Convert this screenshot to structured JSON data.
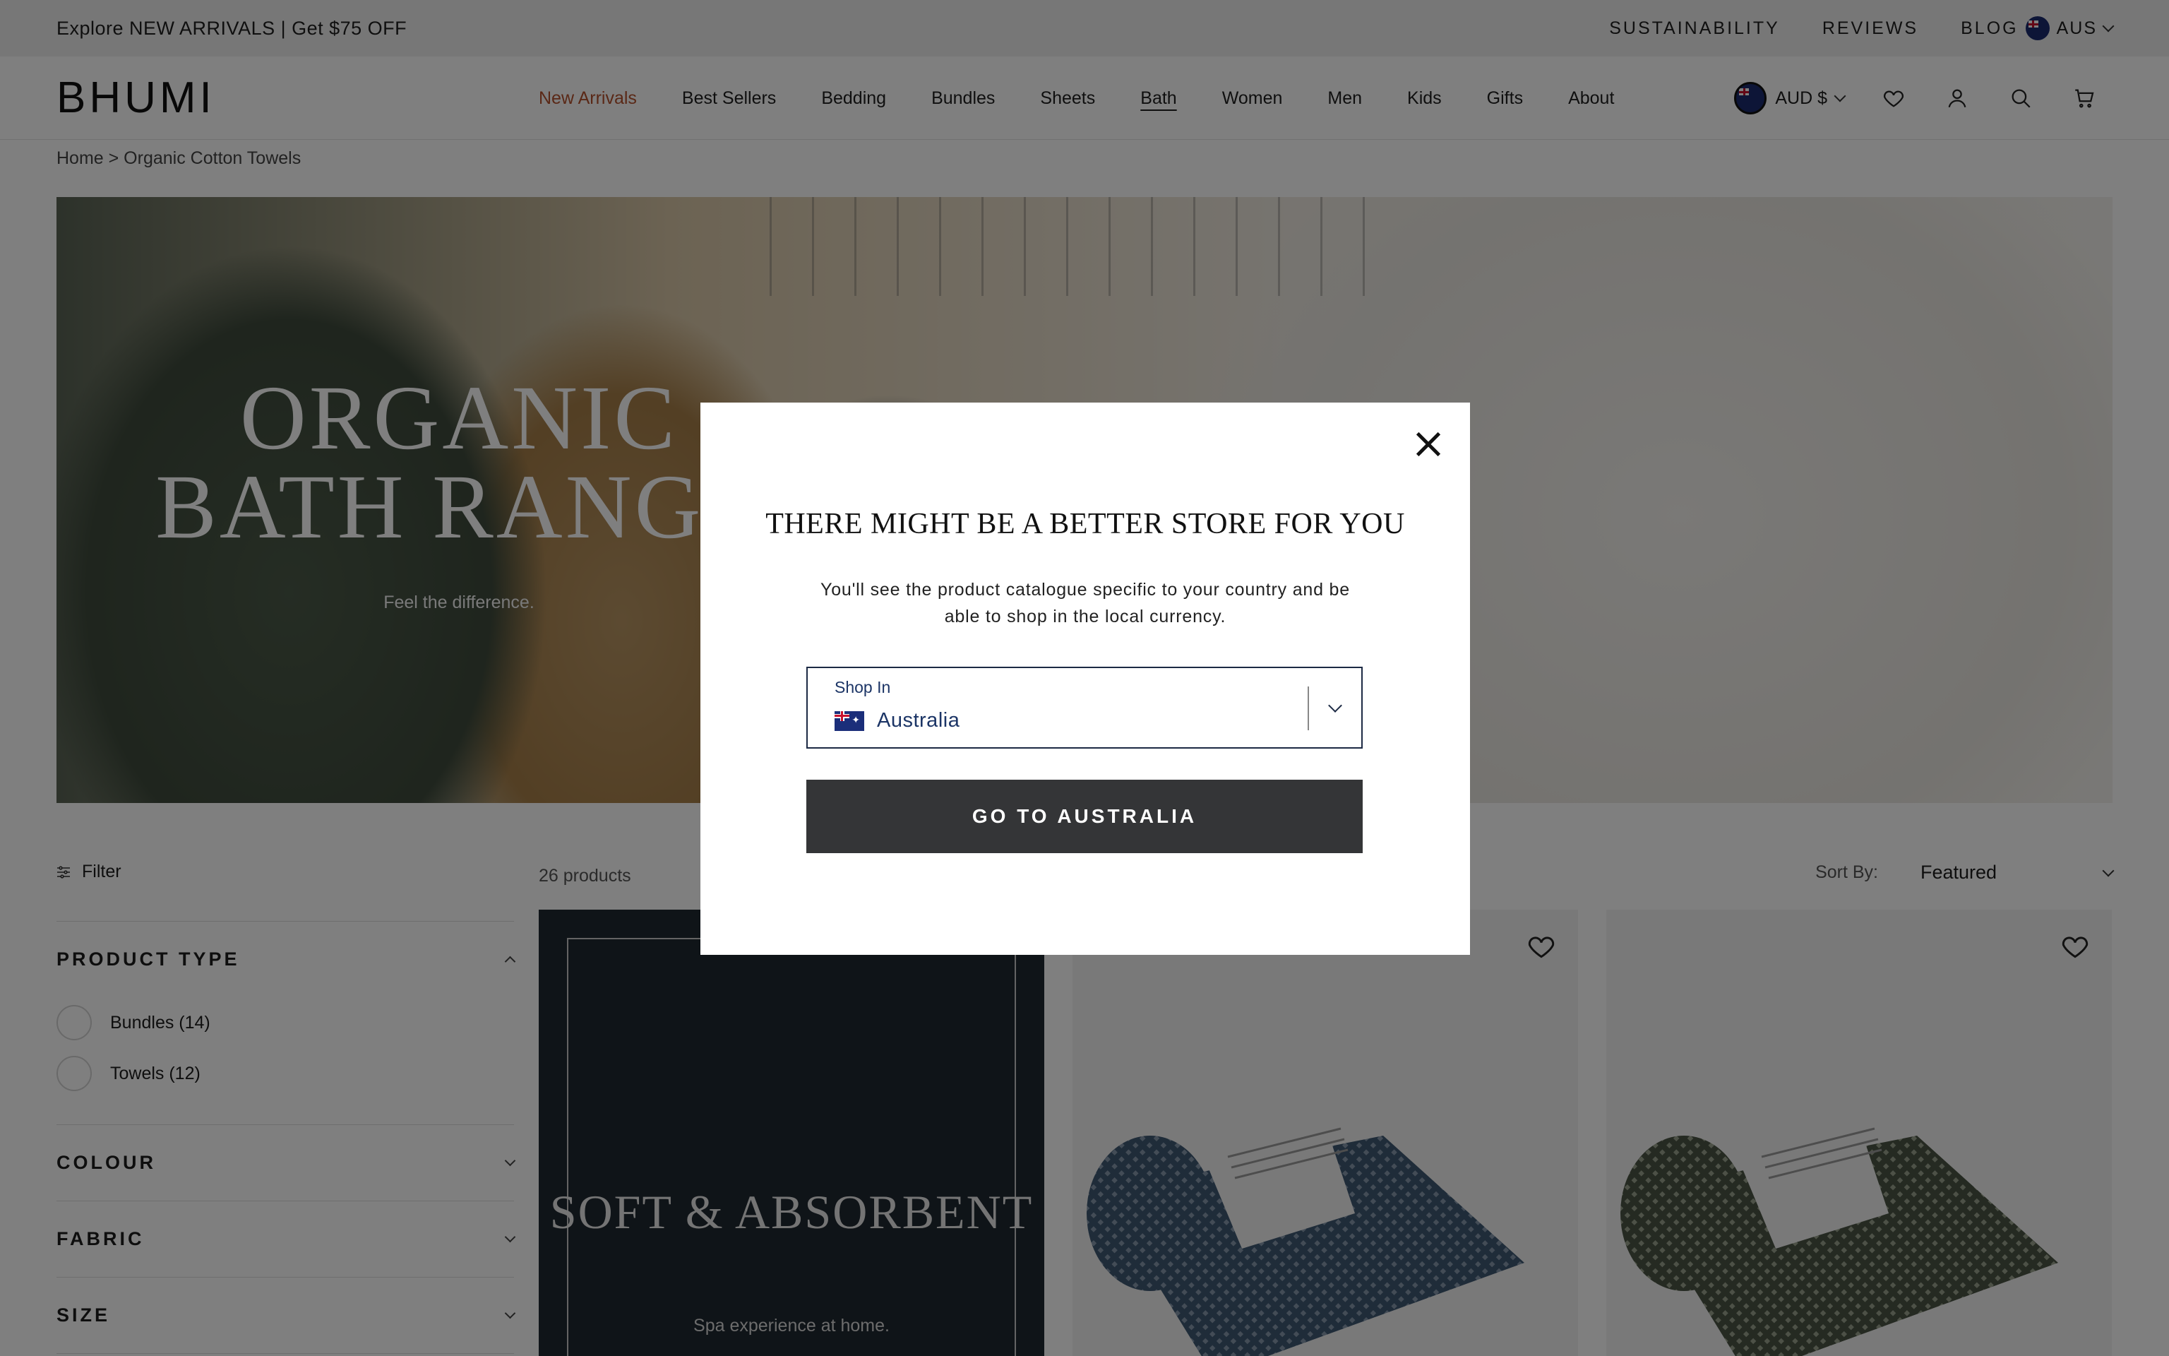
{
  "announcement": {
    "promo": "Explore NEW ARRIVALS | Get $75 OFF"
  },
  "utility_nav": {
    "items": [
      "SUSTAINABILITY",
      "REVIEWS",
      "BLOG"
    ],
    "country": "AUS"
  },
  "header": {
    "logo": "BHUMI",
    "menu": [
      "New Arrivals",
      "Best Sellers",
      "Bedding",
      "Bundles",
      "Sheets",
      "Bath",
      "Women",
      "Men",
      "Kids",
      "Gifts",
      "About"
    ],
    "currency": "AUD $"
  },
  "breadcrumb": "Home > Organic Cotton Towels",
  "hero": {
    "title": "ORGANIC BATH RANGE",
    "subtitle": "Feel the difference."
  },
  "listing": {
    "filter_label": "Filter",
    "product_count": "26 products",
    "sort_label": "Sort By:",
    "sort_value": "Featured"
  },
  "facets": {
    "product_type": {
      "title": "PRODUCT TYPE",
      "options": [
        "Bundles (14)",
        "Towels (12)"
      ]
    },
    "colour": "COLOUR",
    "fabric": "FABRIC",
    "size": "SIZE"
  },
  "promo_card": {
    "title": "SOFT & ABSORBENT",
    "subtitle": "Spa experience at home."
  },
  "modal": {
    "title": "THERE MIGHT BE A BETTER STORE FOR YOU",
    "message": "You'll see the product catalogue specific to your country and be able to shop in the local currency.",
    "select_label": "Shop In",
    "select_value": "Australia",
    "button": "GO TO AUSTRALIA"
  },
  "colors": {
    "accent": "#b5502c",
    "button": "#343537",
    "overlay": "rgba(0,0,0,0.5)",
    "promo_bg": "#1f2830"
  }
}
